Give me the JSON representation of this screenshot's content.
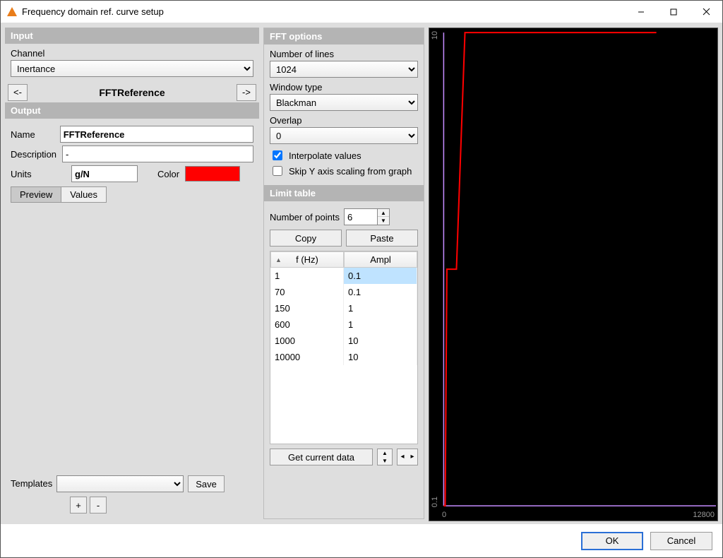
{
  "window": {
    "title": "Frequency domain ref. curve setup"
  },
  "input": {
    "header": "Input",
    "channel_label": "Channel",
    "channel_value": "Inertance",
    "nav_prev": "<-",
    "nav_title": "FFTReference",
    "nav_next": "->"
  },
  "output": {
    "header": "Output",
    "name_label": "Name",
    "name_value": "FFTReference",
    "desc_label": "Description",
    "desc_value": "-",
    "units_label": "Units",
    "units_value": "g/N",
    "color_label": "Color",
    "color_value": "#ff0000",
    "tab_preview": "Preview",
    "tab_values": "Values"
  },
  "templates": {
    "label": "Templates",
    "save": "Save",
    "add": "+",
    "remove": "-"
  },
  "fft": {
    "header": "FFT options",
    "lines_label": "Number of lines",
    "lines_value": "1024",
    "window_label": "Window type",
    "window_value": "Blackman",
    "overlap_label": "Overlap",
    "overlap_value": "0",
    "interpolate_label": "Interpolate values",
    "interpolate_checked": true,
    "skipY_label": "Skip Y axis scaling from graph",
    "skipY_checked": false
  },
  "limit": {
    "header": "Limit table",
    "npts_label": "Number of points",
    "npts_value": "6",
    "copy": "Copy",
    "paste": "Paste",
    "col_f": "f (Hz)",
    "col_a": "Ampl",
    "rows": [
      {
        "f": "1",
        "a": "0.1"
      },
      {
        "f": "70",
        "a": "0.1"
      },
      {
        "f": "150",
        "a": "1"
      },
      {
        "f": "600",
        "a": "1"
      },
      {
        "f": "1000",
        "a": "10"
      },
      {
        "f": "10000",
        "a": "10"
      }
    ],
    "get_current": "Get current data"
  },
  "plot": {
    "y_top": "10",
    "y_bottom": "0.1",
    "x_left": "0",
    "x_right": "12800",
    "curve_color": "#ff0000",
    "axis_color": "#c58cff"
  },
  "chart_data": {
    "type": "line",
    "x": [
      1,
      70,
      150,
      600,
      1000,
      10000
    ],
    "y": [
      0.1,
      0.1,
      1,
      1,
      10,
      10
    ],
    "xlabel": "f (Hz)",
    "ylabel": "Ampl",
    "xlim": [
      0,
      12800
    ],
    "ylim": [
      0.1,
      10
    ],
    "yscale": "log",
    "title": ""
  },
  "footer": {
    "ok": "OK",
    "cancel": "Cancel"
  }
}
